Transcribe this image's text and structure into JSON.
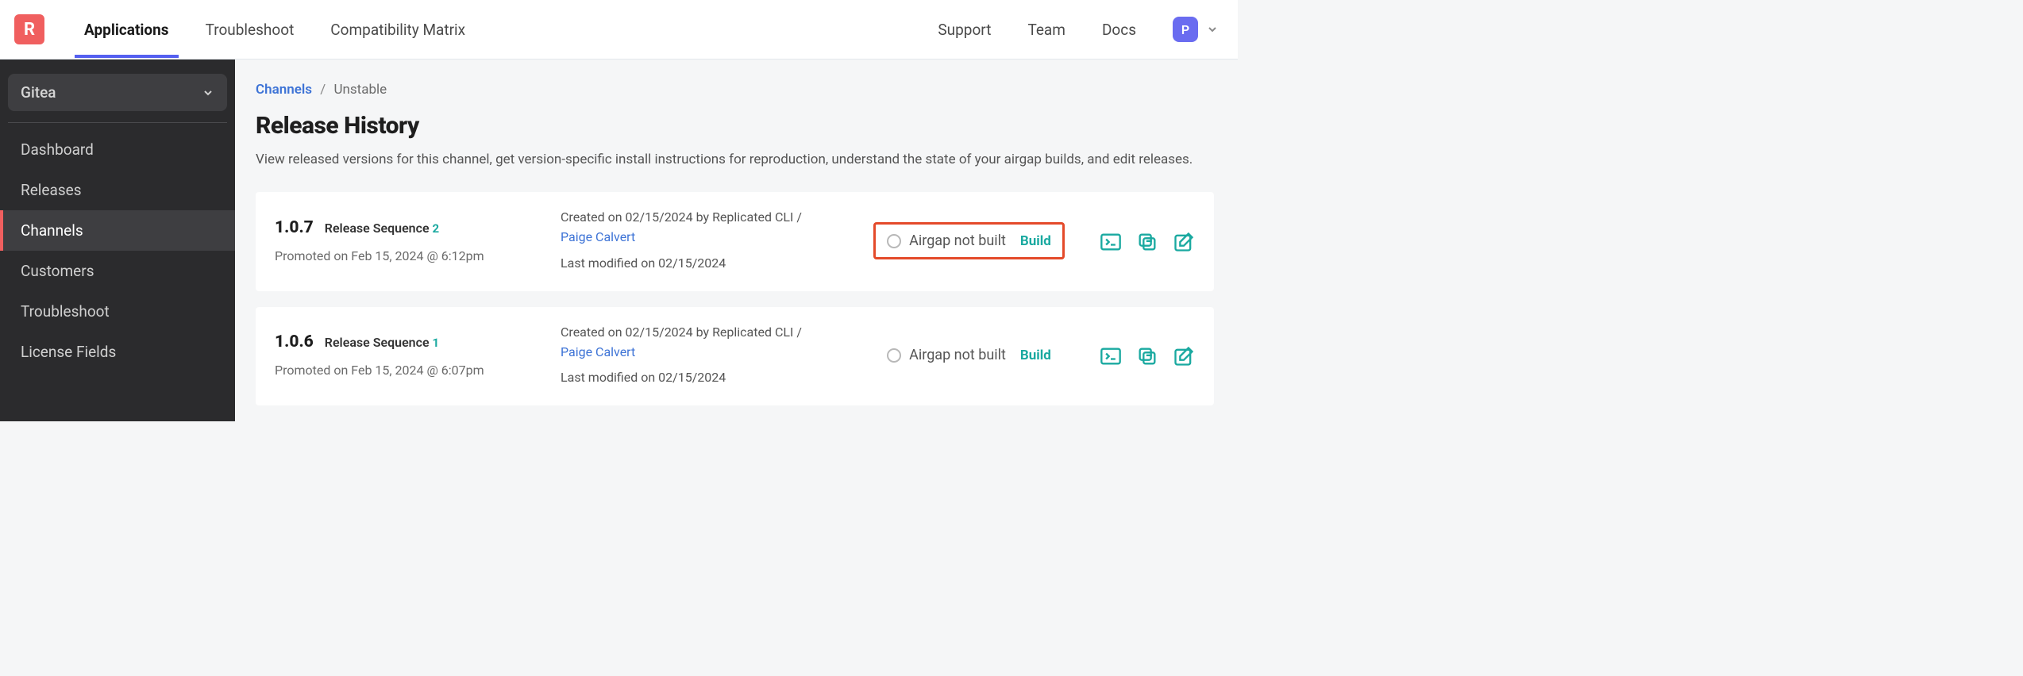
{
  "logo_letter": "R",
  "topnav": {
    "applications": "Applications",
    "troubleshoot": "Troubleshoot",
    "compat": "Compatibility Matrix"
  },
  "topright": {
    "support": "Support",
    "team": "Team",
    "docs": "Docs",
    "avatar_letter": "P"
  },
  "sidebar": {
    "app_name": "Gitea",
    "items": {
      "dashboard": "Dashboard",
      "releases": "Releases",
      "channels": "Channels",
      "customers": "Customers",
      "troubleshoot": "Troubleshoot",
      "license_fields": "License Fields"
    }
  },
  "breadcrumb": {
    "channels": "Channels",
    "current": "Unstable"
  },
  "page": {
    "title": "Release History",
    "description": "View released versions for this channel, get version-specific install instructions for reproduction, understand the state of your airgap builds, and edit releases."
  },
  "labels": {
    "release_sequence": "Release Sequence",
    "promoted_prefix": "Promoted on ",
    "created_prefix": "Created on ",
    "created_mid": " by ",
    "last_modified_prefix": "Last modified on ",
    "airgap_not_built": "Airgap not built",
    "build": "Build"
  },
  "releases": [
    {
      "version": "1.0.7",
      "sequence": "2",
      "promoted": "Feb 15, 2024 @ 6:12pm",
      "created_date": "02/15/2024",
      "created_by_tool": "Replicated CLI",
      "created_by_user": "Paige Calvert",
      "last_modified": "02/15/2024",
      "highlight_airgap": true
    },
    {
      "version": "1.0.6",
      "sequence": "1",
      "promoted": "Feb 15, 2024 @ 6:07pm",
      "created_date": "02/15/2024",
      "created_by_tool": "Replicated CLI",
      "created_by_user": "Paige Calvert",
      "last_modified": "02/15/2024",
      "highlight_airgap": false
    }
  ]
}
